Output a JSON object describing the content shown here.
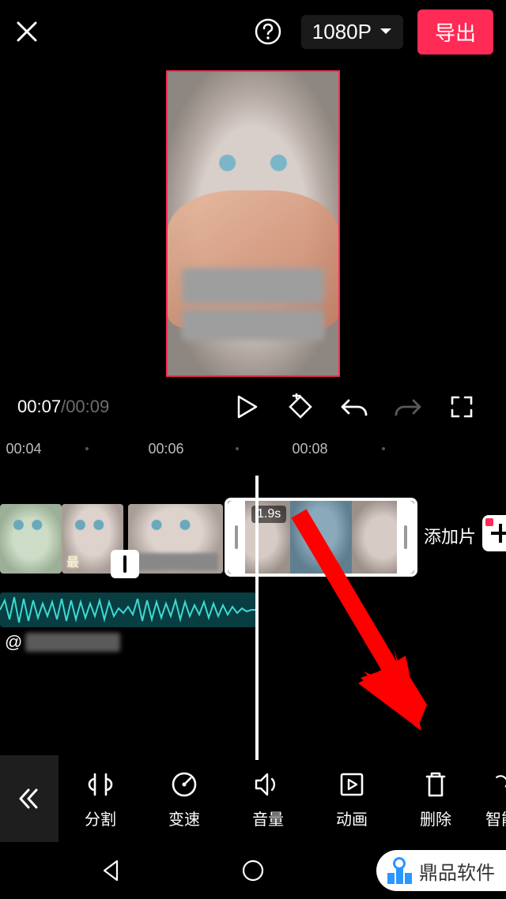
{
  "header": {
    "resolution": "1080P",
    "export_label": "导出"
  },
  "transport": {
    "current_time": "00:07",
    "duration": "00:09"
  },
  "ruler": {
    "labels": [
      "00:04",
      "00:06",
      "00:08"
    ]
  },
  "timeline": {
    "selected_clip_duration": "1.9s",
    "add_clip_label": "添加片",
    "track_prefix": "@"
  },
  "toolbar": {
    "items": [
      {
        "id": "split",
        "label": "分割"
      },
      {
        "id": "speed",
        "label": "变速"
      },
      {
        "id": "volume",
        "label": "音量"
      },
      {
        "id": "anim",
        "label": "动画"
      },
      {
        "id": "delete",
        "label": "删除"
      },
      {
        "id": "smart",
        "label": "智能"
      }
    ]
  },
  "watermark": {
    "text": "鼎品软件"
  },
  "subtitle_partial": "最"
}
